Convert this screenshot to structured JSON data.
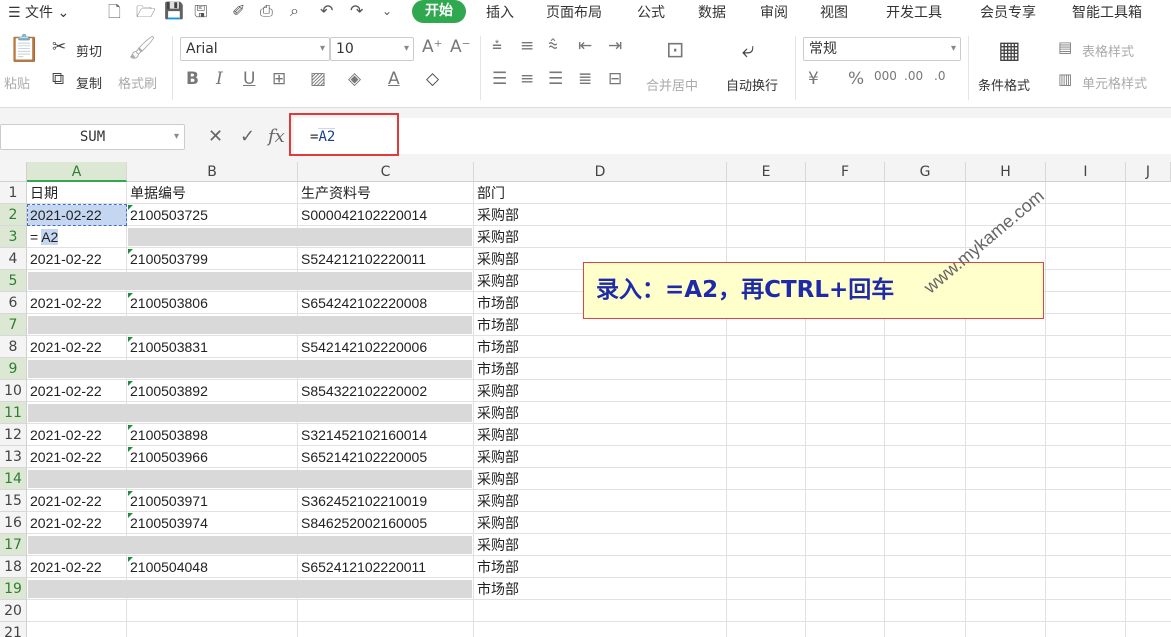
{
  "menubar": {
    "file_label": "文件",
    "tabs": [
      "开始",
      "插入",
      "页面布局",
      "公式",
      "数据",
      "审阅",
      "视图",
      "开发工具",
      "会员专享",
      "智能工具箱"
    ]
  },
  "ribbon": {
    "paste": "粘贴",
    "cut": "剪切",
    "copy": "复制",
    "format_painter": "格式刷",
    "font_name": "Arial",
    "font_size": "10",
    "merge_center": "合并居中",
    "wrap_text": "自动换行",
    "number_format": "常规",
    "conditional_format": "条件格式",
    "table_style": "表格样式",
    "cell_style": "单元格样式"
  },
  "formula_bar": {
    "name_box": "SUM",
    "fx": "fx",
    "prefix": "=",
    "ref": "A2"
  },
  "columns": [
    "A",
    "B",
    "C",
    "D",
    "E",
    "F",
    "G",
    "H",
    "I",
    "J"
  ],
  "rows": [
    {
      "n": "1",
      "a": "日期",
      "b": "单据编号",
      "c": "生产资料号",
      "d": "部门"
    },
    {
      "n": "2",
      "a": "2021-02-22",
      "b": "2100503725",
      "c": "S000042102220014",
      "d": "采购部"
    },
    {
      "n": "3",
      "a": "",
      "b": "",
      "c": "",
      "d": "采购部"
    },
    {
      "n": "4",
      "a": "2021-02-22",
      "b": "2100503799",
      "c": "S524212102220011",
      "d": "采购部"
    },
    {
      "n": "5",
      "a": "",
      "b": "",
      "c": "",
      "d": "采购部"
    },
    {
      "n": "6",
      "a": "2021-02-22",
      "b": "2100503806",
      "c": "S654242102220008",
      "d": "市场部"
    },
    {
      "n": "7",
      "a": "",
      "b": "",
      "c": "",
      "d": "市场部"
    },
    {
      "n": "8",
      "a": "2021-02-22",
      "b": "2100503831",
      "c": "S542142102220006",
      "d": "市场部"
    },
    {
      "n": "9",
      "a": "",
      "b": "",
      "c": "",
      "d": "市场部"
    },
    {
      "n": "10",
      "a": "2021-02-22",
      "b": "2100503892",
      "c": "S854322102220002",
      "d": "采购部"
    },
    {
      "n": "11",
      "a": "",
      "b": "",
      "c": "",
      "d": "采购部"
    },
    {
      "n": "12",
      "a": "2021-02-22",
      "b": "2100503898",
      "c": "S321452102160014",
      "d": "采购部"
    },
    {
      "n": "13",
      "a": "2021-02-22",
      "b": "2100503966",
      "c": "S652142102220005",
      "d": "采购部"
    },
    {
      "n": "14",
      "a": "",
      "b": "",
      "c": "",
      "d": "采购部"
    },
    {
      "n": "15",
      "a": "2021-02-22",
      "b": "2100503971",
      "c": "S362452102210019",
      "d": "采购部"
    },
    {
      "n": "16",
      "a": "2021-02-22",
      "b": "2100503974",
      "c": "S846252002160005",
      "d": "采购部"
    },
    {
      "n": "17",
      "a": "",
      "b": "",
      "c": "",
      "d": "采购部"
    },
    {
      "n": "18",
      "a": "2021-02-22",
      "b": "2100504048",
      "c": "S652412102220011",
      "d": "市场部"
    },
    {
      "n": "19",
      "a": "",
      "b": "",
      "c": "",
      "d": "市场部"
    },
    {
      "n": "20",
      "a": "",
      "b": "",
      "c": "",
      "d": ""
    },
    {
      "n": "21",
      "a": "",
      "b": "",
      "c": "",
      "d": ""
    }
  ],
  "editing_cell": {
    "prefix": "=",
    "ref": "A2"
  },
  "annotation": "录入：=A2，再CTRL+回车",
  "watermark": "www.mykame.com",
  "colors": {
    "accent_green": "#2fa84f",
    "annotation_border": "#dd4444",
    "annotation_text": "#1f2aa8",
    "blank_fill": "#d9d9d9"
  }
}
